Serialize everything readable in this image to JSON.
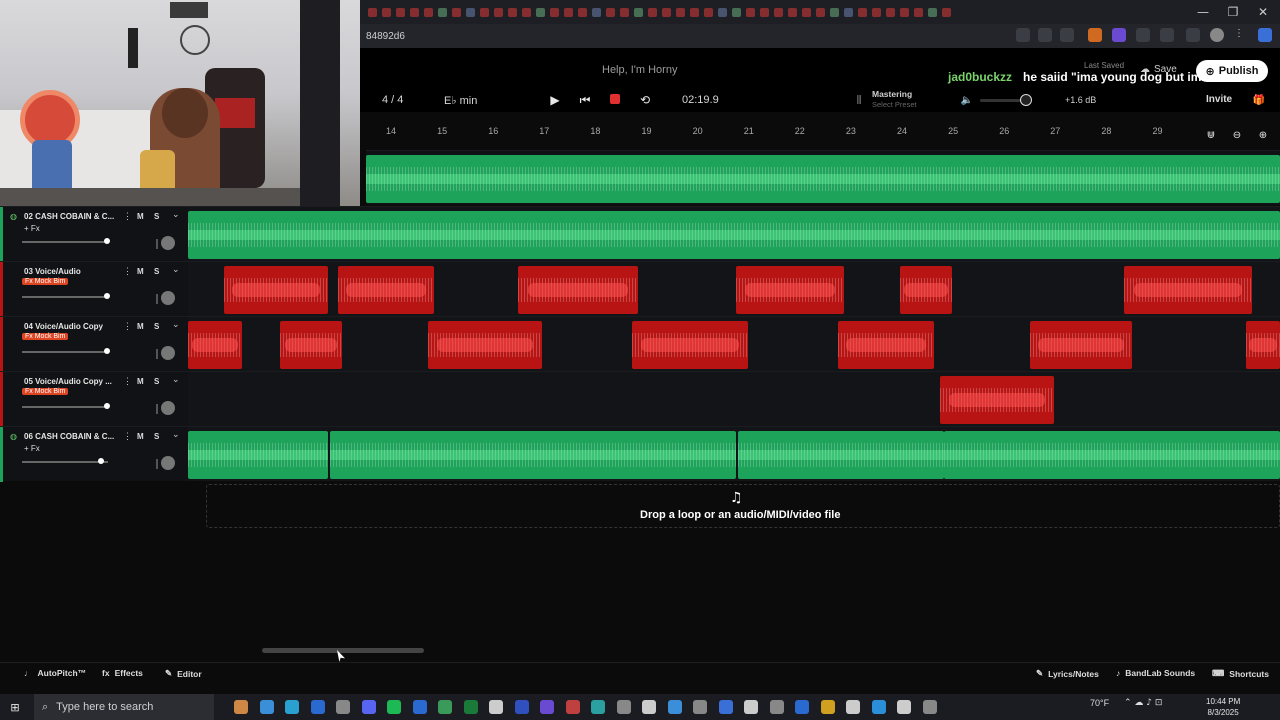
{
  "browser": {
    "url": "84892d6",
    "tab_count": 42
  },
  "song": {
    "title": "Help, I'm Horny",
    "last_saved": "Last Saved",
    "save_label": "Save",
    "publish_label": "Publish"
  },
  "chat": {
    "user": "jad0buckzz",
    "message": "he saiid \"ima young dog but im..."
  },
  "transport": {
    "time_signature": "4 / 4",
    "key": "E♭ min",
    "time": "02:19.9",
    "mastering_label": "Mastering",
    "mastering_sub": "Select Preset",
    "gain": "+1.6 dB",
    "invite_label": "Invite"
  },
  "ruler": {
    "bars": [
      "14",
      "15",
      "16",
      "17",
      "18",
      "19",
      "20",
      "21",
      "22",
      "23",
      "24",
      "25",
      "26",
      "27",
      "28",
      "29"
    ]
  },
  "tracks": [
    {
      "name": "02 CASH COBAIN & C...",
      "fx": "+ Fx",
      "fx_red": false,
      "color": "#1ea35a",
      "volume": 0.98
    },
    {
      "name": "03 Voice/Audio",
      "fx": "Fx Mock Bim",
      "fx_red": true,
      "color": "#b81414",
      "volume": 0.98
    },
    {
      "name": "04 Voice/Audio Copy",
      "fx": "Fx Mock Bim",
      "fx_red": true,
      "color": "#b81414",
      "volume": 0.98
    },
    {
      "name": "05 Voice/Audio Copy ...",
      "fx": "Fx Mock Bim",
      "fx_red": true,
      "color": "#b81414",
      "volume": 0.98
    },
    {
      "name": "06 CASH COBAIN & C...",
      "fx": "+ Fx",
      "fx_red": false,
      "color": "#1ea35a",
      "volume": 0.9
    }
  ],
  "track_buttons": {
    "mute": "M",
    "solo": "S"
  },
  "dropzone": {
    "text": "Drop a loop or an audio/MIDI/video file"
  },
  "bottom": {
    "autopitch": "AutoPitch™",
    "effects": "Effects",
    "editor": "Editor",
    "lyrics": "Lyrics/Notes",
    "sounds": "BandLab Sounds",
    "shortcuts": "Shortcuts"
  },
  "taskbar": {
    "search_placeholder": "Type here to search",
    "weather": "70°F",
    "time": "10:44 PM",
    "date": "8/3/2025"
  },
  "colors": {
    "green_clip": "#1ea35a",
    "red_clip": "#b81414",
    "record": "#e03030",
    "chat_user": "#7ad36a"
  }
}
